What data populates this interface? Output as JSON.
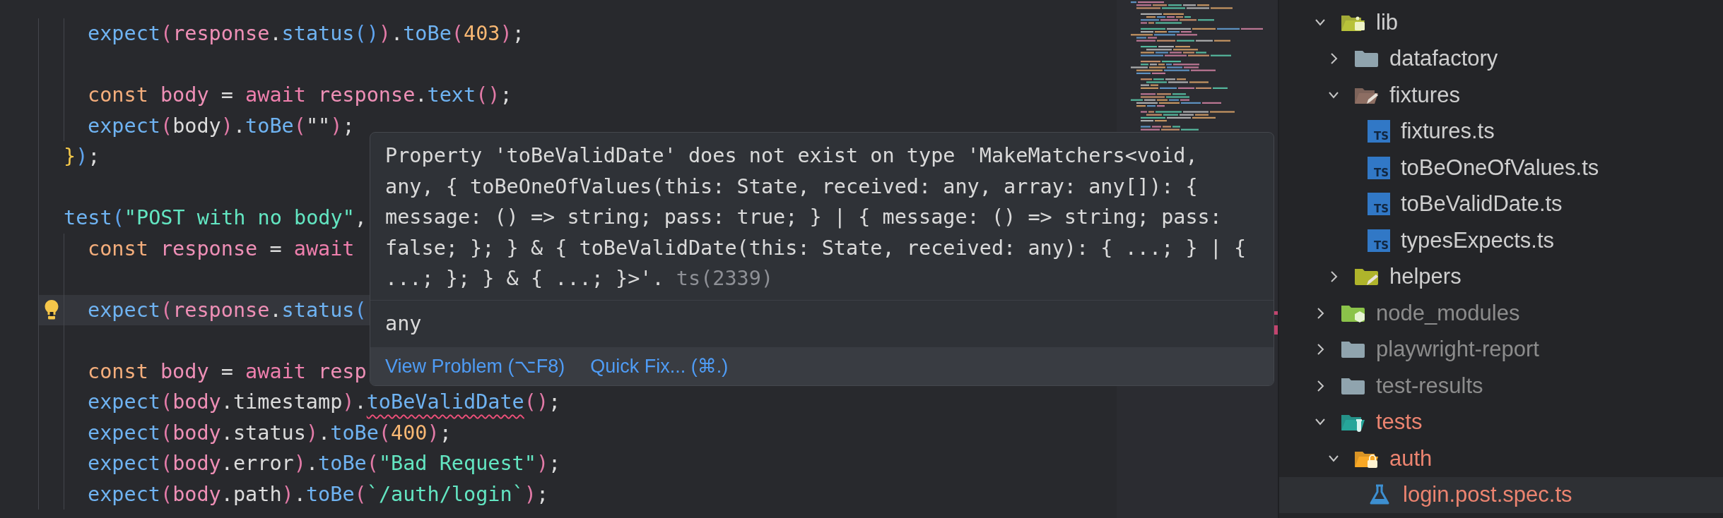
{
  "editor": {
    "lines": [
      {
        "indented": true,
        "highlighted": false,
        "lightbulb": false,
        "tokens": [
          {
            "kind": "fn",
            "text": "expect"
          },
          {
            "kind": "b1",
            "text": "("
          },
          {
            "kind": "var",
            "text": "response"
          },
          {
            "kind": "p",
            "text": "."
          },
          {
            "kind": "fn",
            "text": "status"
          },
          {
            "kind": "b2",
            "text": "()"
          },
          {
            "kind": "b1",
            "text": ")"
          },
          {
            "kind": "p",
            "text": "."
          },
          {
            "kind": "fn",
            "text": "toBe"
          },
          {
            "kind": "b1",
            "text": "("
          },
          {
            "kind": "num",
            "text": "403"
          },
          {
            "kind": "b1",
            "text": ")"
          },
          {
            "kind": "p",
            "text": ";"
          }
        ]
      },
      {
        "indented": true,
        "highlighted": false,
        "lightbulb": false
      },
      {
        "indented": true,
        "highlighted": false,
        "lightbulb": false,
        "tokens": [
          {
            "kind": "kw",
            "text": "const "
          },
          {
            "kind": "var",
            "text": "body"
          },
          {
            "kind": "p",
            "text": " = "
          },
          {
            "kind": "kw2",
            "text": "await "
          },
          {
            "kind": "var",
            "text": "response"
          },
          {
            "kind": "p",
            "text": "."
          },
          {
            "kind": "fn",
            "text": "text"
          },
          {
            "kind": "b1",
            "text": "()"
          },
          {
            "kind": "p",
            "text": ";"
          }
        ]
      },
      {
        "indented": true,
        "highlighted": false,
        "lightbulb": false,
        "tokens": [
          {
            "kind": "fn",
            "text": "expect"
          },
          {
            "kind": "b1",
            "text": "("
          },
          {
            "kind": "p",
            "text": "body"
          },
          {
            "kind": "b1",
            "text": ")"
          },
          {
            "kind": "p",
            "text": "."
          },
          {
            "kind": "fn",
            "text": "toBe"
          },
          {
            "kind": "b1",
            "text": "("
          },
          {
            "kind": "p",
            "text": "\"\""
          },
          {
            "kind": "b1",
            "text": ")"
          },
          {
            "kind": "p",
            "text": ";"
          }
        ]
      },
      {
        "indented": false,
        "highlighted": false,
        "lightbulb": false,
        "tokens": [
          {
            "kind": "b3",
            "text": "}"
          },
          {
            "kind": "b2",
            "text": ")"
          },
          {
            "kind": "p",
            "text": ";"
          }
        ]
      },
      {
        "indented": false,
        "highlighted": false,
        "lightbulb": false
      },
      {
        "indented": false,
        "highlighted": false,
        "lightbulb": false,
        "tokens": [
          {
            "kind": "fn",
            "text": "test"
          },
          {
            "kind": "b2",
            "text": "("
          },
          {
            "kind": "str",
            "text": "\"POST with no body\""
          },
          {
            "kind": "p",
            "text": ","
          }
        ]
      },
      {
        "indented": true,
        "highlighted": false,
        "lightbulb": false,
        "tokens": [
          {
            "kind": "kw",
            "text": "const "
          },
          {
            "kind": "var",
            "text": "response"
          },
          {
            "kind": "p",
            "text": " = "
          },
          {
            "kind": "kw2",
            "text": "await"
          }
        ]
      },
      {
        "indented": true,
        "highlighted": false,
        "lightbulb": false
      },
      {
        "indented": true,
        "highlighted": true,
        "lightbulb": true,
        "tokens": [
          {
            "kind": "fn",
            "text": "expect"
          },
          {
            "kind": "b1",
            "text": "("
          },
          {
            "kind": "var",
            "text": "response"
          },
          {
            "kind": "p",
            "text": "."
          },
          {
            "kind": "fn",
            "text": "status"
          },
          {
            "kind": "b2",
            "text": "("
          }
        ]
      },
      {
        "indented": true,
        "highlighted": false,
        "lightbulb": false
      },
      {
        "indented": true,
        "highlighted": false,
        "lightbulb": false,
        "tokens": [
          {
            "kind": "kw",
            "text": "const "
          },
          {
            "kind": "var",
            "text": "body"
          },
          {
            "kind": "p",
            "text": " = "
          },
          {
            "kind": "kw2",
            "text": "await "
          },
          {
            "kind": "var",
            "text": "resp"
          }
        ]
      },
      {
        "indented": true,
        "highlighted": false,
        "lightbulb": false,
        "tokens": [
          {
            "kind": "fn",
            "text": "expect"
          },
          {
            "kind": "b1",
            "text": "("
          },
          {
            "kind": "var",
            "text": "body"
          },
          {
            "kind": "p",
            "text": ".timestamp"
          },
          {
            "kind": "b1",
            "text": ")"
          },
          {
            "kind": "p",
            "text": "."
          },
          {
            "kind": "errfn",
            "text": "toBeValidDate"
          },
          {
            "kind": "b1",
            "text": "()"
          },
          {
            "kind": "p",
            "text": ";"
          }
        ]
      },
      {
        "indented": true,
        "highlighted": false,
        "lightbulb": false,
        "tokens": [
          {
            "kind": "fn",
            "text": "expect"
          },
          {
            "kind": "b1",
            "text": "("
          },
          {
            "kind": "var",
            "text": "body"
          },
          {
            "kind": "p",
            "text": ".status"
          },
          {
            "kind": "b1",
            "text": ")"
          },
          {
            "kind": "p",
            "text": "."
          },
          {
            "kind": "fn",
            "text": "toBe"
          },
          {
            "kind": "b1",
            "text": "("
          },
          {
            "kind": "num",
            "text": "400"
          },
          {
            "kind": "b1",
            "text": ")"
          },
          {
            "kind": "p",
            "text": ";"
          }
        ]
      },
      {
        "indented": true,
        "highlighted": false,
        "lightbulb": false,
        "tokens": [
          {
            "kind": "fn",
            "text": "expect"
          },
          {
            "kind": "b1",
            "text": "("
          },
          {
            "kind": "var",
            "text": "body"
          },
          {
            "kind": "p",
            "text": ".error"
          },
          {
            "kind": "b1",
            "text": ")"
          },
          {
            "kind": "p",
            "text": "."
          },
          {
            "kind": "fn",
            "text": "toBe"
          },
          {
            "kind": "b1",
            "text": "("
          },
          {
            "kind": "str",
            "text": "\"Bad Request\""
          },
          {
            "kind": "b1",
            "text": ")"
          },
          {
            "kind": "p",
            "text": ";"
          }
        ]
      },
      {
        "indented": true,
        "highlighted": false,
        "lightbulb": false,
        "tokens": [
          {
            "kind": "fn",
            "text": "expect"
          },
          {
            "kind": "b1",
            "text": "("
          },
          {
            "kind": "var",
            "text": "body"
          },
          {
            "kind": "p",
            "text": ".path"
          },
          {
            "kind": "b1",
            "text": ")"
          },
          {
            "kind": "p",
            "text": "."
          },
          {
            "kind": "fn",
            "text": "toBe"
          },
          {
            "kind": "b1",
            "text": "("
          },
          {
            "kind": "str",
            "text": "`/auth/login`"
          },
          {
            "kind": "b1",
            "text": ")"
          },
          {
            "kind": "p",
            "text": ";"
          }
        ]
      }
    ]
  },
  "hover": {
    "message": "Property 'toBeValidDate' does not exist on type 'MakeMatchers<void, any, { toBeOneOfValues(this: State, received: any, array: any[]): { message: () => string; pass: true; } | { message: () => string; pass: false; }; } & { toBeValidDate(this: State, received: any): { ...; } | { ...; }; } & { ...; }>'.",
    "code": "ts(2339)",
    "type_text": "any",
    "actions": [
      "View Problem (⌥F8)",
      "Quick Fix... (⌘.)"
    ]
  },
  "explorer": {
    "items": [
      {
        "kind": "folder",
        "name": "lib",
        "expanded": true,
        "selected": false,
        "ignored": false,
        "has_problems": false,
        "children": [
          {
            "kind": "folder",
            "name": "datafactory",
            "expanded": false,
            "selected": false,
            "ignored": false,
            "has_problems": false
          },
          {
            "kind": "folder",
            "name": "fixtures",
            "expanded": true,
            "selected": false,
            "ignored": false,
            "has_problems": false,
            "children": [
              {
                "kind": "file",
                "name": "fixtures.ts",
                "icon_label": "TS",
                "selected": false,
                "ignored": false,
                "has_problems": false
              },
              {
                "kind": "file",
                "name": "toBeOneOfValues.ts",
                "icon_label": "TS",
                "selected": false,
                "ignored": false,
                "has_problems": false
              },
              {
                "kind": "file",
                "name": "toBeValidDate.ts",
                "icon_label": "TS",
                "selected": false,
                "ignored": false,
                "has_problems": false
              },
              {
                "kind": "file",
                "name": "typesExpects.ts",
                "icon_label": "TS",
                "selected": false,
                "ignored": false,
                "has_problems": false
              }
            ]
          },
          {
            "kind": "folder",
            "name": "helpers",
            "expanded": false,
            "selected": false,
            "ignored": false,
            "has_problems": false
          }
        ]
      },
      {
        "kind": "folder",
        "name": "node_modules",
        "expanded": false,
        "selected": false,
        "ignored": true,
        "has_problems": false
      },
      {
        "kind": "folder",
        "name": "playwright-report",
        "expanded": false,
        "selected": false,
        "ignored": true,
        "has_problems": false
      },
      {
        "kind": "folder",
        "name": "test-results",
        "expanded": false,
        "selected": false,
        "ignored": true,
        "has_problems": false
      },
      {
        "kind": "folder",
        "name": "tests",
        "expanded": true,
        "selected": false,
        "ignored": false,
        "has_problems": true,
        "children": [
          {
            "kind": "folder",
            "name": "auth",
            "expanded": true,
            "selected": false,
            "ignored": false,
            "has_problems": true,
            "children": [
              {
                "kind": "file",
                "name": "login.post.spec.ts",
                "selected": true,
                "ignored": false,
                "has_problems": true
              }
            ]
          }
        ]
      }
    ]
  }
}
